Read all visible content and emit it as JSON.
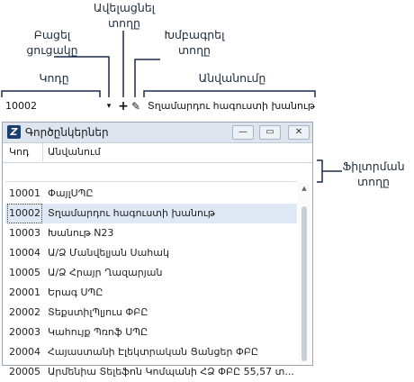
{
  "callouts": {
    "add_row": "Ավելացնել\nտողը",
    "open_list": "Բացել\nցուցակը",
    "edit_row": "Խմբագրել\nտողը",
    "code": "Կոդը",
    "name": "Անվանումը",
    "filter_row": "Ֆիլտրման\nտողը"
  },
  "toolbar": {
    "code_value": "10002",
    "dropdown_glyph": "▾",
    "add_glyph": "+",
    "edit_glyph": "✎",
    "name_value": "Տղամարդու հագուստի խանութ"
  },
  "window": {
    "icon_letter": "Z",
    "title": "Գործընկերներ",
    "minimize": "—",
    "maximize": "▭",
    "close": "✕"
  },
  "grid": {
    "columns": [
      "Կոդ",
      "Անվանում"
    ],
    "rows": [
      {
        "code": "10001",
        "name": "ՓայլՍՊԸ",
        "selected": false
      },
      {
        "code": "10002",
        "name": "Տղամարդու հագուստի խանութ",
        "selected": true
      },
      {
        "code": "10003",
        "name": "Խանութ N23",
        "selected": false
      },
      {
        "code": "10004",
        "name": "Ա/Ձ Մանվելյան Սահակ",
        "selected": false
      },
      {
        "code": "10005",
        "name": "Ա/Ձ Հրայր Ղազարյան",
        "selected": false
      },
      {
        "code": "20001",
        "name": "Երագ ՍՊԸ",
        "selected": false
      },
      {
        "code": "20002",
        "name": "ՏեքստիլՊլյուս  ՓԲԸ",
        "selected": false
      },
      {
        "code": "20003",
        "name": "Կահույք Պռոֆ ՍՊԸ",
        "selected": false
      },
      {
        "code": "20004",
        "name": "Հայաստանի Էլեկտրական Ցանցեր ՓԲԸ",
        "selected": false
      },
      {
        "code": "20005",
        "name": "Արմենիա Տելեֆոն Կոմպանի ՀՁ ՓԲԸ 55,57 տ...",
        "selected": false
      }
    ]
  }
}
